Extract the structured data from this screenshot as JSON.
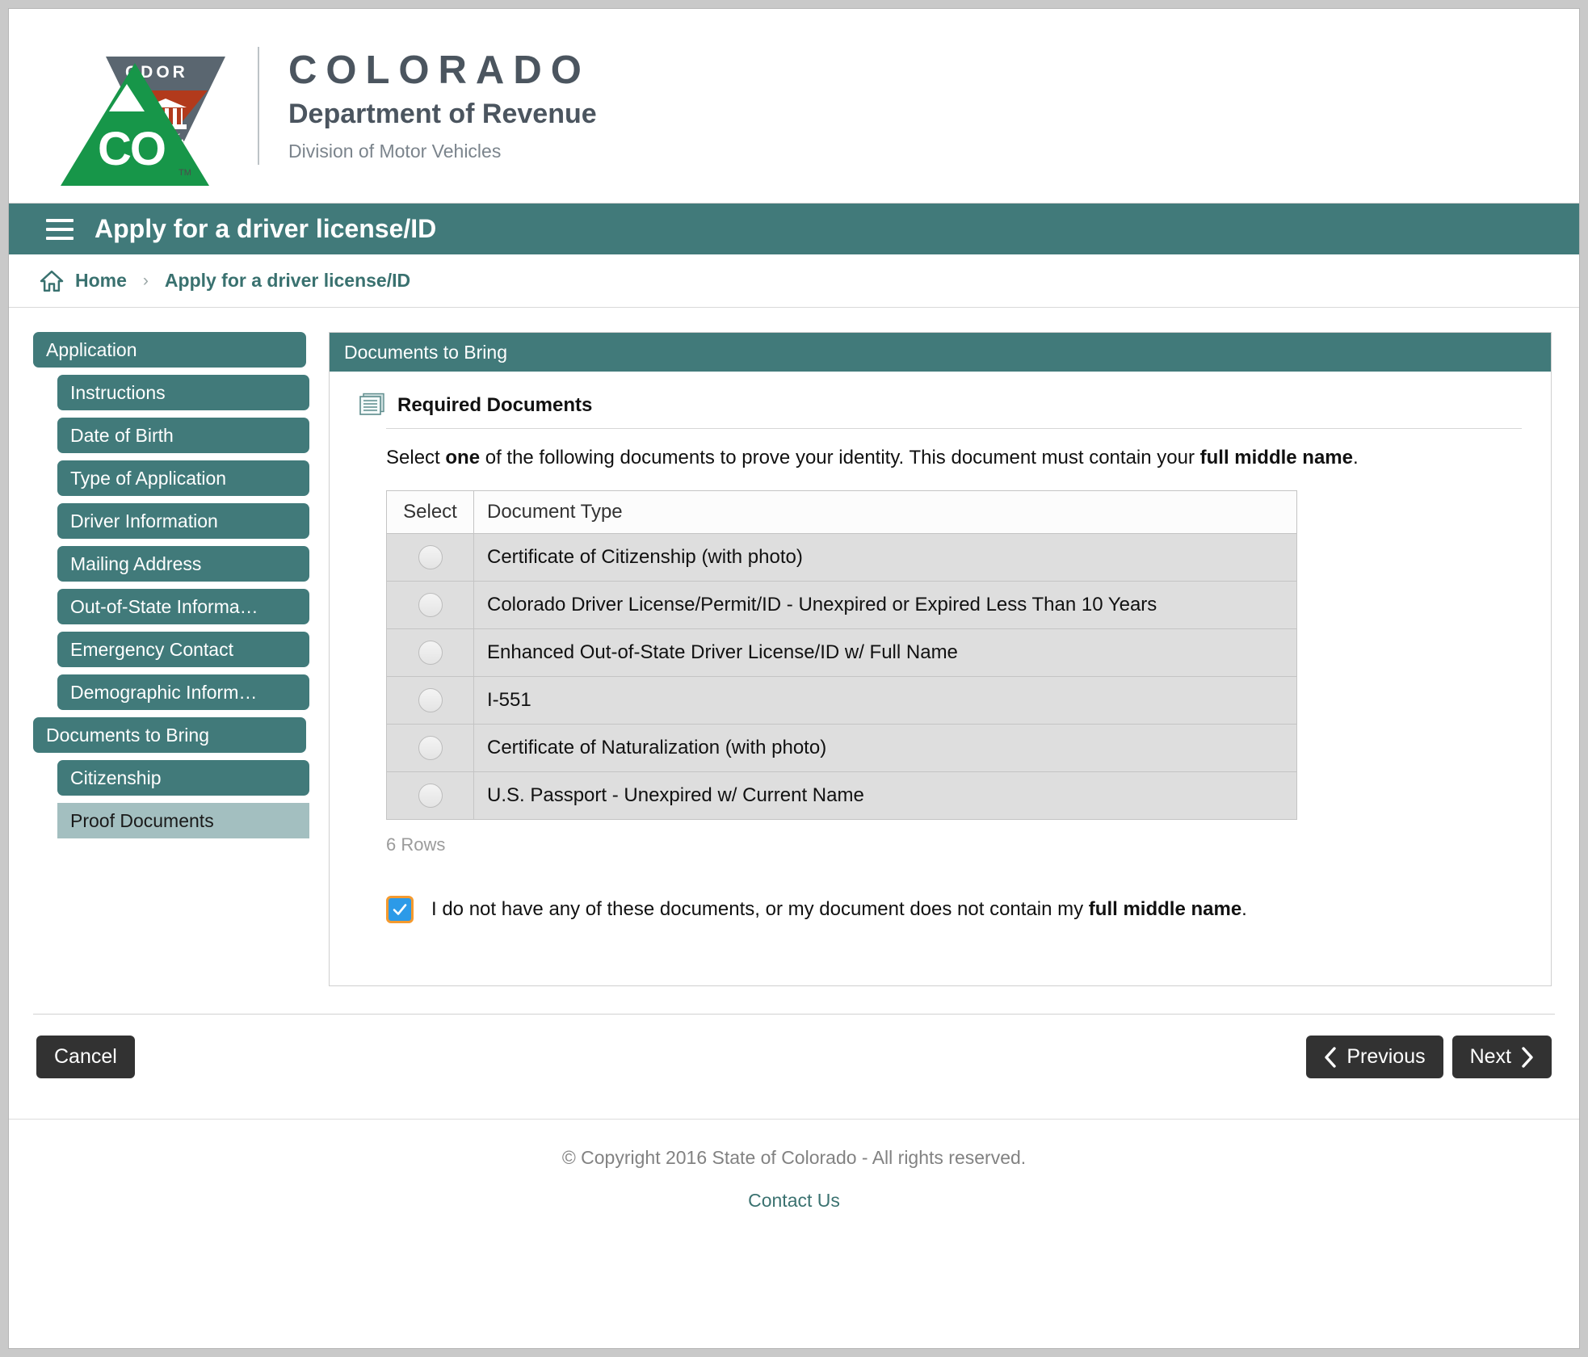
{
  "logo": {
    "agency_badge": "CDOR",
    "state_abbr": "CO",
    "trademark": "TM",
    "title": "COLORADO",
    "subtitle": "Department of Revenue",
    "division": "Division of Motor Vehicles"
  },
  "appbar": {
    "menu_icon": "hamburger-menu-icon",
    "title": "Apply for a driver license/ID"
  },
  "breadcrumb": {
    "home_icon": "home-icon",
    "home": "Home",
    "separator": "›",
    "current": "Apply for a driver license/ID"
  },
  "sidebar": {
    "items": [
      {
        "label": "Application",
        "level": 0,
        "active": false
      },
      {
        "label": "Instructions",
        "level": 1,
        "active": false
      },
      {
        "label": "Date of Birth",
        "level": 1,
        "active": false
      },
      {
        "label": "Type of Application",
        "level": 1,
        "active": false
      },
      {
        "label": "Driver Information",
        "level": 1,
        "active": false
      },
      {
        "label": "Mailing Address",
        "level": 1,
        "active": false
      },
      {
        "label": "Out-of-State Informa…",
        "level": 1,
        "active": false
      },
      {
        "label": "Emergency Contact",
        "level": 1,
        "active": false
      },
      {
        "label": "Demographic Inform…",
        "level": 1,
        "active": false
      },
      {
        "label": "Documents to Bring",
        "level": 0,
        "active": false
      },
      {
        "label": "Citizenship",
        "level": 1,
        "active": false
      },
      {
        "label": "Proof Documents",
        "level": 1,
        "active": true
      }
    ]
  },
  "panel": {
    "header": "Documents to Bring",
    "section_icon": "document-lines-icon",
    "section_title": "Required Documents",
    "instruction": {
      "part1": "Select ",
      "bold1": "one",
      "part2": " of the following documents to prove your identity. This document must contain your ",
      "bold2": "full middle name",
      "part3": "."
    },
    "table": {
      "columns": [
        "Select",
        "Document Type"
      ],
      "rows": [
        {
          "selected": false,
          "document_type": "Certificate of Citizenship (with photo)"
        },
        {
          "selected": false,
          "document_type": "Colorado Driver License/Permit/ID - Unexpired or Expired Less Than 10 Years"
        },
        {
          "selected": false,
          "document_type": "Enhanced Out-of-State Driver License/ID w/ Full Name"
        },
        {
          "selected": false,
          "document_type": "I-551"
        },
        {
          "selected": false,
          "document_type": "Certificate of Naturalization (with photo)"
        },
        {
          "selected": false,
          "document_type": "U.S. Passport - Unexpired w/ Current Name"
        }
      ],
      "row_count_label": "6 Rows"
    },
    "checkbox": {
      "checked": true,
      "part1": "I do not have any of these documents, or my document does not contain my ",
      "bold1": "full middle name",
      "part2": "."
    }
  },
  "actions": {
    "cancel": "Cancel",
    "previous": "Previous",
    "next": "Next",
    "previous_icon": "chevron-left-icon",
    "next_icon": "chevron-right-icon"
  },
  "footer": {
    "copyright": "© Copyright 2016 State of Colorado - All rights reserved.",
    "contact": "Contact Us"
  },
  "colors": {
    "teal": "#417a7a",
    "active_nav": "#a3bfc0",
    "link": "#3b7270",
    "button_dark": "#323232",
    "checkbox_blue": "#2c9ae8",
    "focus_orange": "#f59a2e",
    "logo_green": "#179649",
    "logo_red": "#b23a1c",
    "logo_gray": "#5a6670"
  }
}
